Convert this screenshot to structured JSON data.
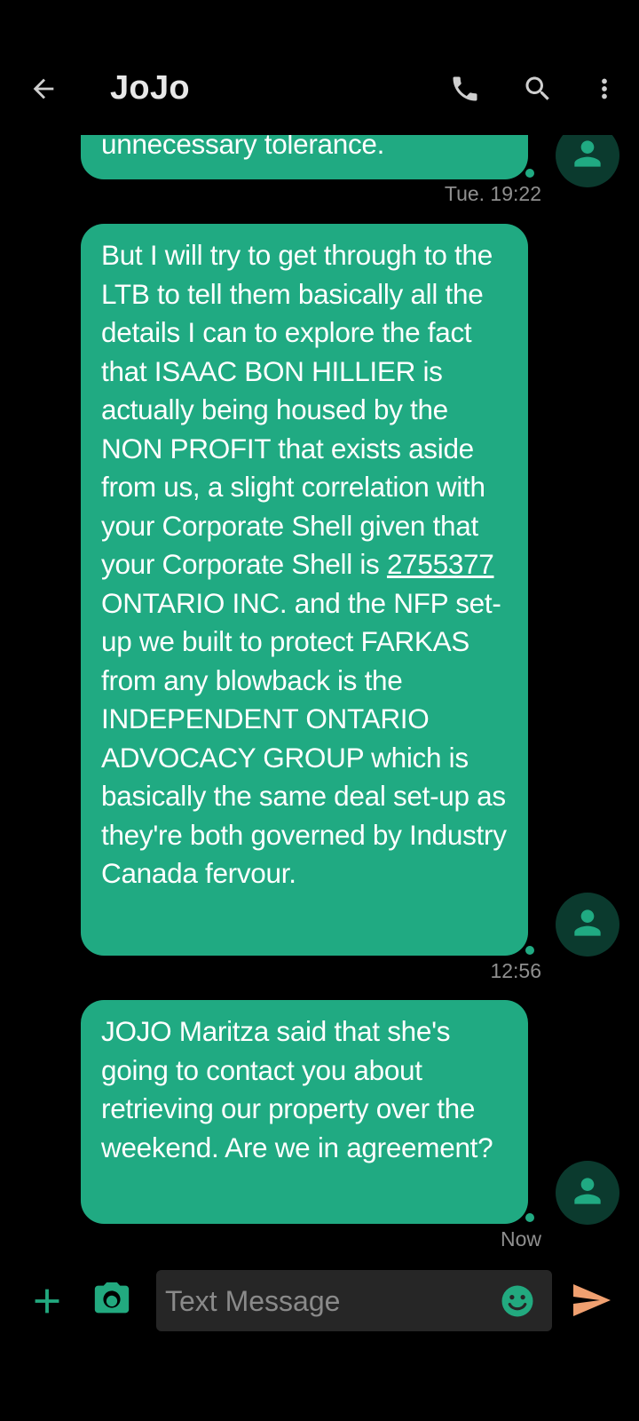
{
  "header": {
    "title": "JoJo",
    "icons": [
      "back-arrow-icon",
      "phone-icon",
      "search-icon",
      "more-vert-icon"
    ]
  },
  "messages": [
    {
      "text": "unnecessary tolerance.",
      "time": "Tue. 19:22"
    },
    {
      "text_parts": [
        "But I will try to get through to the LTB to tell them basically all the details I can to explore the fact that ISAAC BON HILLIER is actually being housed by the NON PROFIT that exists aside from us, a slight correlation with your Corporate Shell given that your Corporate Shell is ",
        "2755377",
        " ONTARIO INC. and the NFP set-up we built to protect FARKAS from any blowback is the INDEPENDENT ONTARIO ADVOCACY GROUP which is basically the same deal set-up as they're both governed by Industry Canada fervour."
      ],
      "time": "12:56"
    },
    {
      "text": "JOJO Maritza said that she's going to contact you about retrieving our property over the weekend. Are we in agreement?",
      "time": "Now"
    }
  ],
  "composer": {
    "placeholder": "Text Message",
    "icons": [
      "add-icon",
      "camera-icon",
      "emoji-icon",
      "send-icon"
    ]
  },
  "colors": {
    "background": "#000000",
    "bubble": "#20aa82",
    "accent_icon": "#22a97f",
    "send": "#f0a070",
    "avatar_bg": "#0b3a2e",
    "time_text": "#8f8f8f"
  }
}
